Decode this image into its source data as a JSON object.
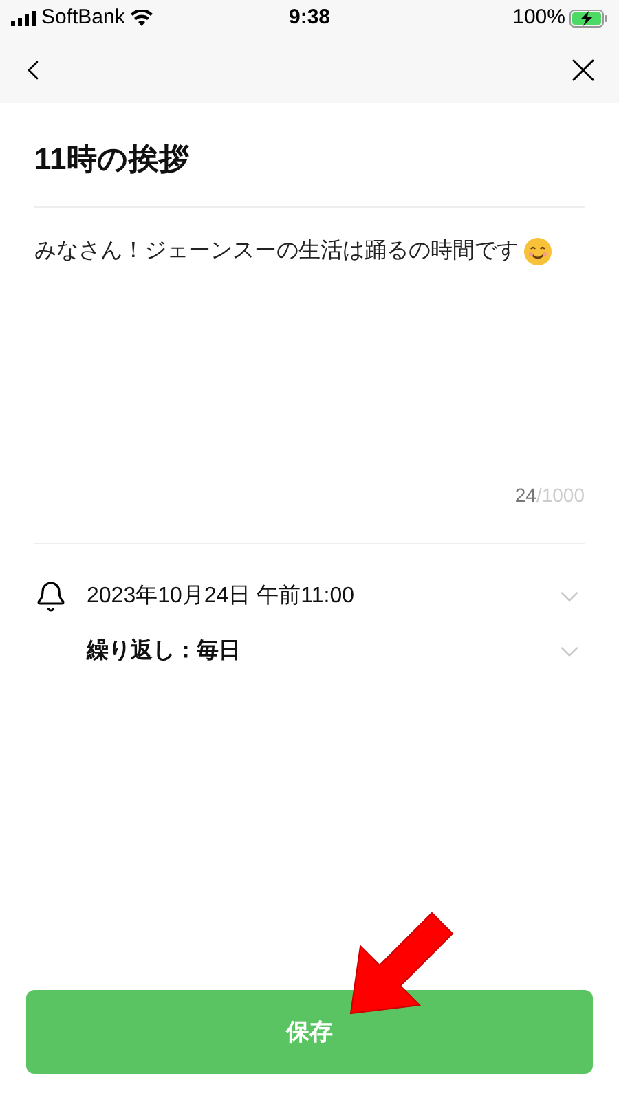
{
  "status_bar": {
    "carrier": "SoftBank",
    "time": "9:38",
    "battery": "100%"
  },
  "title": "11時の挨拶",
  "message": {
    "value": "みなさん！ジェーンスーの生活は踊るの時間です",
    "count": "24",
    "limit": "/1000"
  },
  "reminder": {
    "datetime": "2023年10月24日 午前11:00",
    "repeat": "繰り返し：毎日"
  },
  "save_button": "保存"
}
